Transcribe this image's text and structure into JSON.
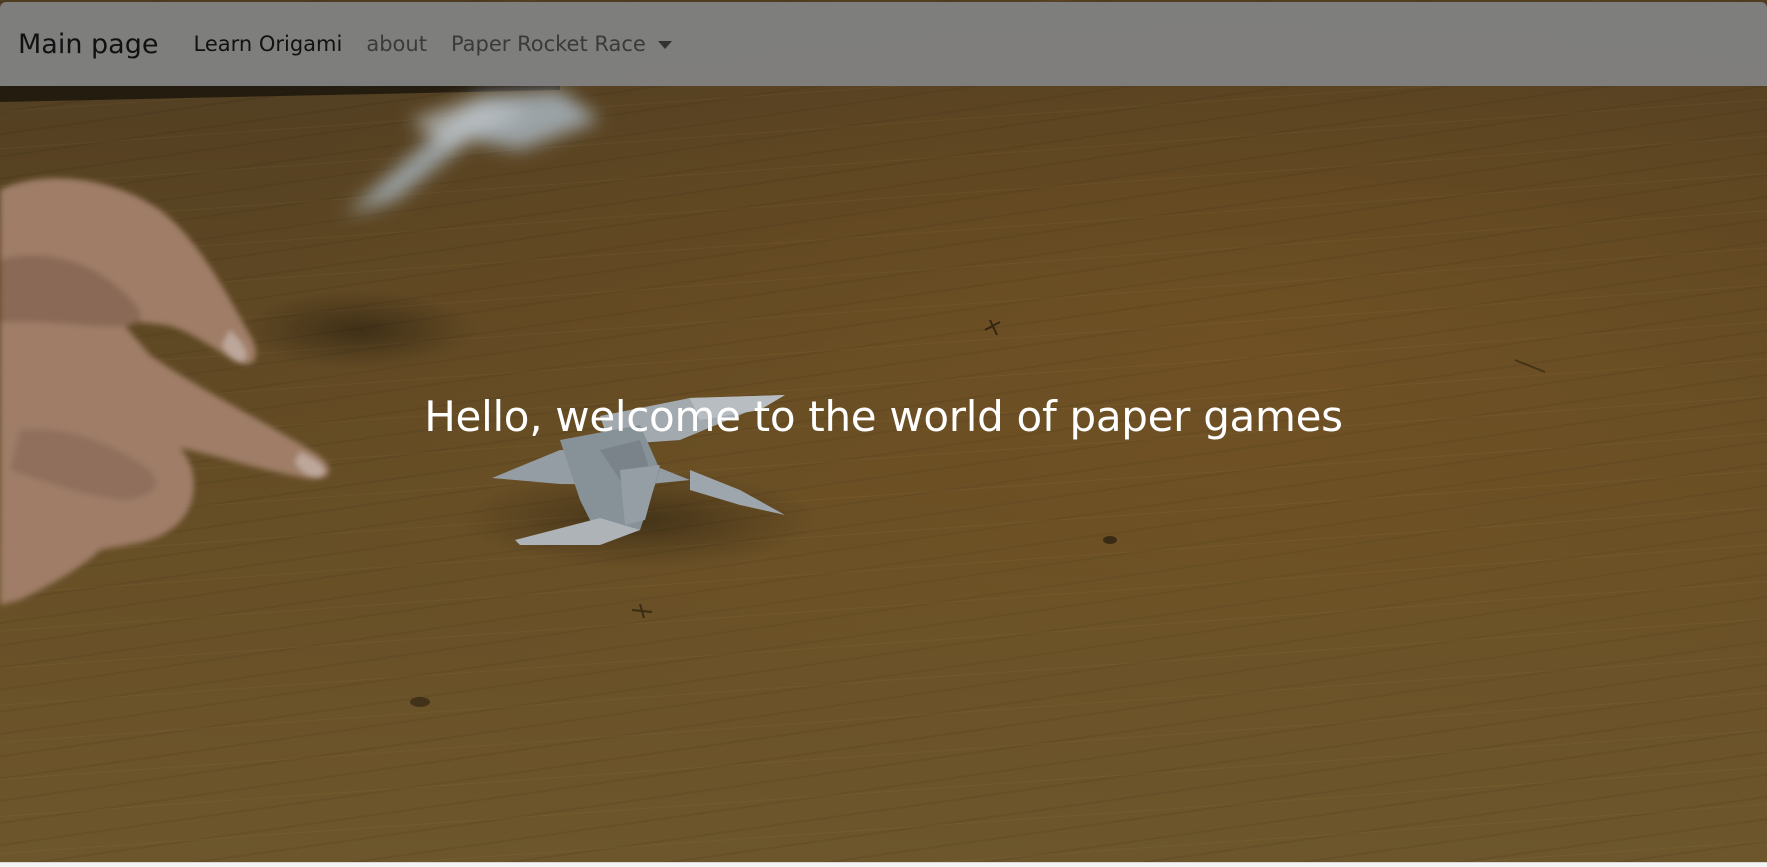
{
  "navbar": {
    "brand": "Main page",
    "links": [
      {
        "label": "Learn Origami",
        "active": true
      },
      {
        "label": "about",
        "active": false
      }
    ],
    "dropdown": {
      "label": "Paper Rocket Race",
      "icon": "caret-down-icon"
    },
    "background_color": "#808080"
  },
  "hero": {
    "headline": "Hello, welcome to the world of paper games",
    "text_color": "#ffffff"
  }
}
